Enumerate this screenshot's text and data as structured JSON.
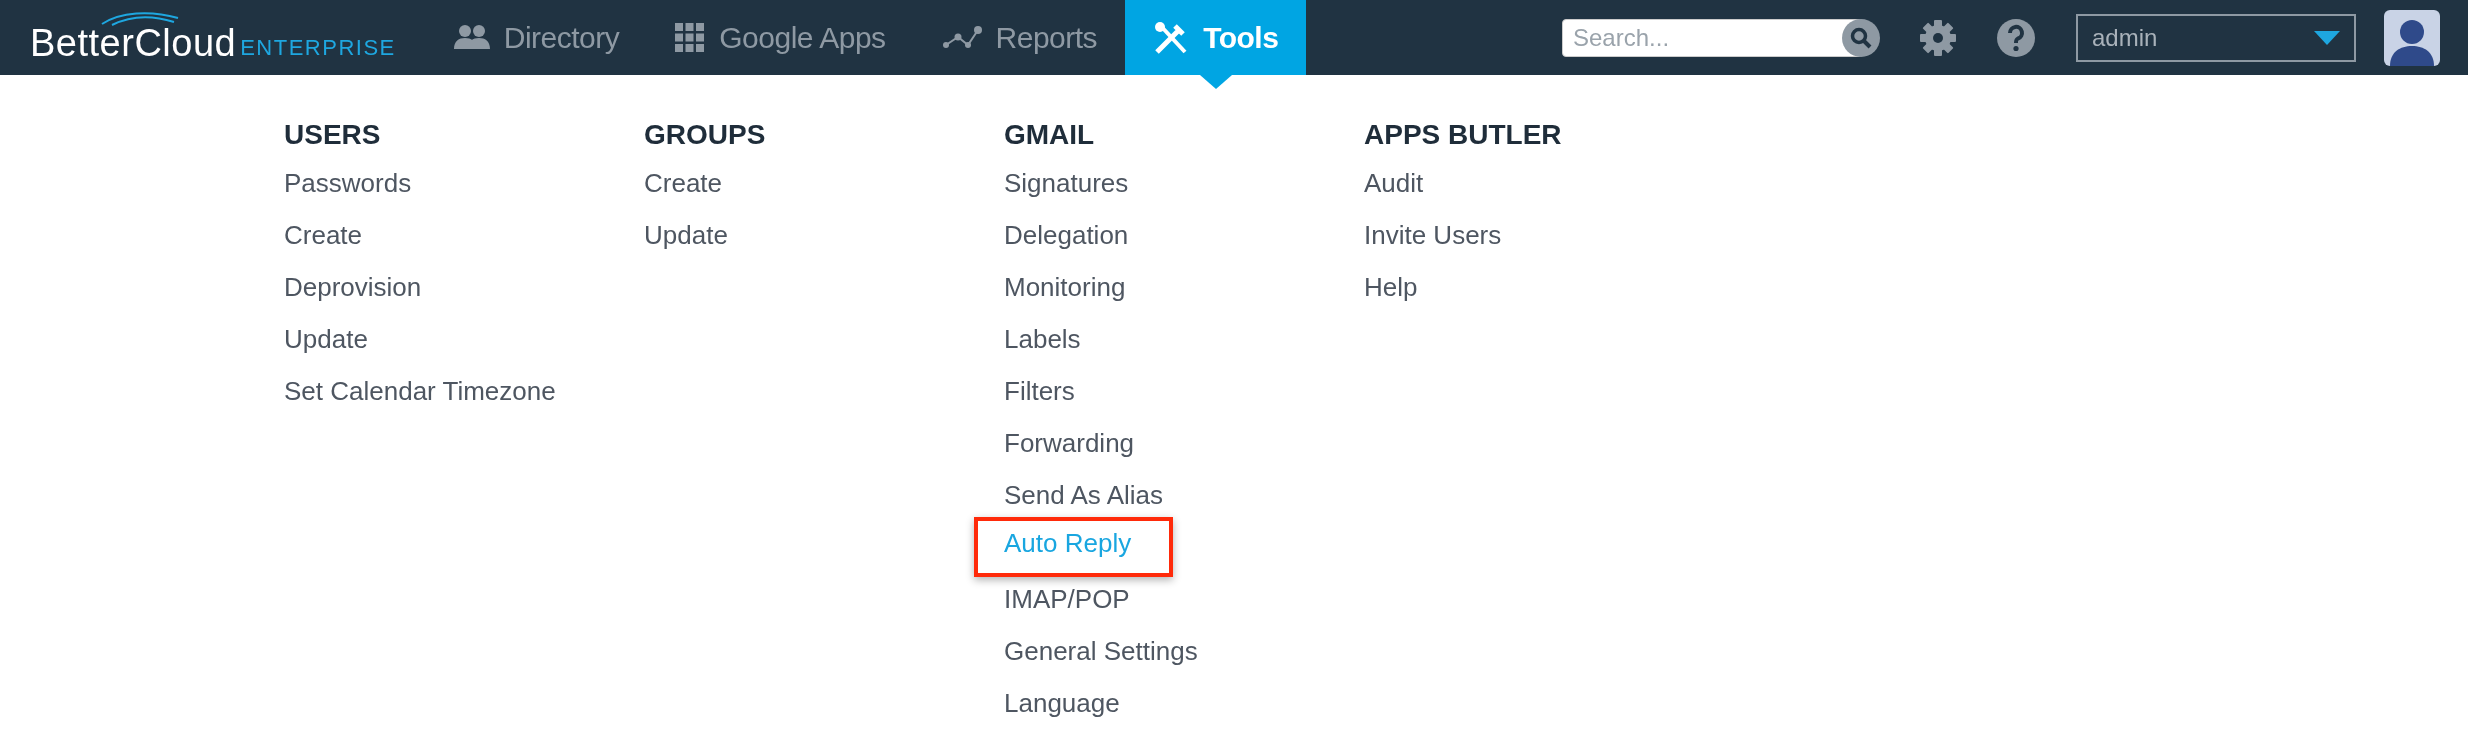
{
  "brand": {
    "name": "BetterCloud",
    "edition": "ENTERPRISE"
  },
  "nav": [
    {
      "label": "Directory",
      "kind": "people",
      "selected": false
    },
    {
      "label": "Google Apps",
      "kind": "grid",
      "selected": false
    },
    {
      "label": "Reports",
      "kind": "chart",
      "selected": false
    },
    {
      "label": "Tools",
      "kind": "tools",
      "selected": true
    }
  ],
  "search": {
    "placeholder": "Search..."
  },
  "account": {
    "value": "admin"
  },
  "menu": [
    {
      "title": "USERS",
      "items": [
        {
          "label": "Passwords",
          "selected": false
        },
        {
          "label": "Create",
          "selected": false
        },
        {
          "label": "Deprovision",
          "selected": false
        },
        {
          "label": "Update",
          "selected": false
        },
        {
          "label": "Set Calendar Timezone",
          "selected": false
        }
      ]
    },
    {
      "title": "GROUPS",
      "items": [
        {
          "label": "Create",
          "selected": false
        },
        {
          "label": "Update",
          "selected": false
        }
      ]
    },
    {
      "title": "GMAIL",
      "items": [
        {
          "label": "Signatures",
          "selected": false
        },
        {
          "label": "Delegation",
          "selected": false
        },
        {
          "label": "Monitoring",
          "selected": false
        },
        {
          "label": "Labels",
          "selected": false
        },
        {
          "label": "Filters",
          "selected": false
        },
        {
          "label": "Forwarding",
          "selected": false
        },
        {
          "label": "Send As Alias",
          "selected": false
        },
        {
          "label": "Auto Reply",
          "selected": true
        },
        {
          "label": "IMAP/POP",
          "selected": false
        },
        {
          "label": "General Settings",
          "selected": false
        },
        {
          "label": "Language",
          "selected": false
        }
      ]
    },
    {
      "title": "APPS BUTLER",
      "items": [
        {
          "label": "Audit",
          "selected": false
        },
        {
          "label": "Invite Users",
          "selected": false
        },
        {
          "label": "Help",
          "selected": false
        }
      ]
    }
  ]
}
